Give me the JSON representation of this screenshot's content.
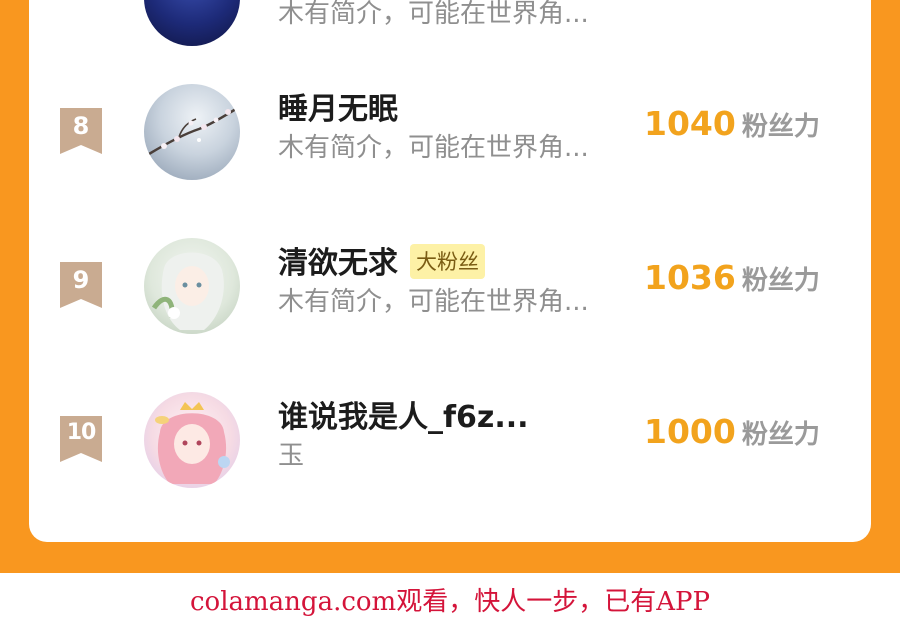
{
  "rows": [
    {
      "rank": "",
      "name": "",
      "badge": "",
      "desc": "木有简介，可能在世界角...",
      "score": "",
      "unit": ""
    },
    {
      "rank": "8",
      "name": "睡月无眠",
      "badge": "",
      "desc": "木有简介，可能在世界角...",
      "score": "1040",
      "unit": "粉丝力"
    },
    {
      "rank": "9",
      "name": "清欲无求",
      "badge": "大粉丝",
      "desc": "木有简介，可能在世界角...",
      "score": "1036",
      "unit": "粉丝力"
    },
    {
      "rank": "10",
      "name": "谁说我是人_f6z...",
      "badge": "",
      "desc": "玉",
      "score": "1000",
      "unit": "粉丝力"
    }
  ],
  "footer": {
    "watermark": "colamanga.com观看，快人一步，已有APP"
  },
  "colors": {
    "background_orange": "#f9971f",
    "score_orange": "#f2a31d",
    "rank_ribbon": "#c9ab91",
    "badge_bg": "#fdf1a6",
    "watermark_red": "#d4143a"
  }
}
